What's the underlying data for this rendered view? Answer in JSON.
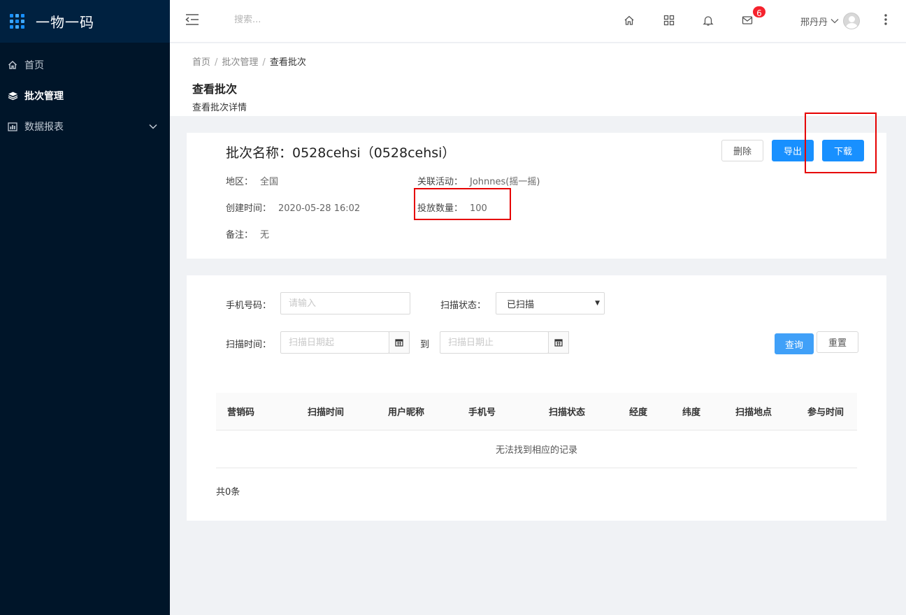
{
  "app": {
    "logo_text": "一物一码"
  },
  "sidebar": {
    "items": [
      {
        "label": "首页",
        "icon": "home-icon"
      },
      {
        "label": "批次管理",
        "icon": "layers-icon",
        "active": true
      },
      {
        "label": "数据报表",
        "icon": "bar-chart-icon",
        "expandable": true
      }
    ]
  },
  "header": {
    "search_placeholder": "搜索...",
    "mail_badge": "6",
    "user_name": "邢丹丹"
  },
  "breadcrumb": {
    "items": [
      "首页",
      "批次管理",
      "查看批次"
    ]
  },
  "page": {
    "title": "查看批次",
    "description": "查看批次详情"
  },
  "batch": {
    "title": "批次名称：0528cehsi（0528cehsi）",
    "region_label": "地区：",
    "region_value": "全国",
    "activity_label": "关联活动：",
    "activity_value": "Johnnes(摇一摇)",
    "created_label": "创建时间：",
    "created_value": "2020-05-28 16:02",
    "quantity_label": "投放数量：",
    "quantity_value": "100",
    "remark_label": "备注：",
    "remark_value": "无",
    "buttons": {
      "delete": "删除",
      "export": "导出",
      "download": "下载"
    }
  },
  "filter": {
    "phone_label": "手机号码：",
    "phone_placeholder": "请输入",
    "status_label": "扫描状态：",
    "status_value": "已扫描",
    "time_label": "扫描时间：",
    "start_placeholder": "扫描日期起",
    "to_label": "到",
    "end_placeholder": "扫描日期止",
    "query_button": "查询",
    "reset_button": "重置"
  },
  "table": {
    "columns": [
      "营销码",
      "扫描时间",
      "用户昵称",
      "手机号",
      "扫描状态",
      "经度",
      "纬度",
      "扫描地点",
      "参与时间"
    ],
    "empty_text": "无法找到相应的记录",
    "total_text": "共0条"
  },
  "colors": {
    "sidebar_bg": "#001529",
    "primary": "#1890ff",
    "badge": "#f5222d",
    "highlight": "#e60000"
  }
}
